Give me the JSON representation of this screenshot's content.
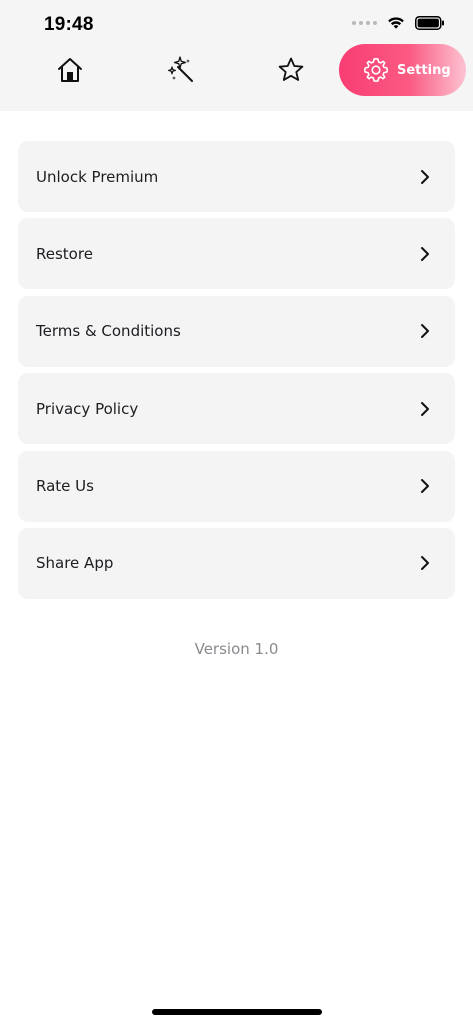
{
  "status_bar": {
    "time": "19:48",
    "signal_icon": "signal-dots-icon",
    "wifi_icon": "wifi-icon",
    "battery_icon": "battery-icon"
  },
  "tabs": [
    {
      "key": "home",
      "icon": "home-icon",
      "label": ""
    },
    {
      "key": "magic",
      "icon": "magic-wand-icon",
      "label": ""
    },
    {
      "key": "favorites",
      "icon": "star-icon",
      "label": ""
    },
    {
      "key": "setting",
      "icon": "gear-icon",
      "label": "Setting",
      "active": true
    }
  ],
  "menu": {
    "items": [
      {
        "label": "Unlock Premium"
      },
      {
        "label": "Restore"
      },
      {
        "label": "Terms & Conditions"
      },
      {
        "label": "Privacy Policy"
      },
      {
        "label": "Rate Us"
      },
      {
        "label": "Share App"
      }
    ]
  },
  "version": "Version 1.0",
  "colors": {
    "accent_start": "#f83d73",
    "accent_end": "#fcc3d2",
    "card_bg": "#f4f4f4",
    "header_bg": "#f5f5f5",
    "text_dark": "#1d1d22",
    "text_muted": "#8a8a8f"
  }
}
